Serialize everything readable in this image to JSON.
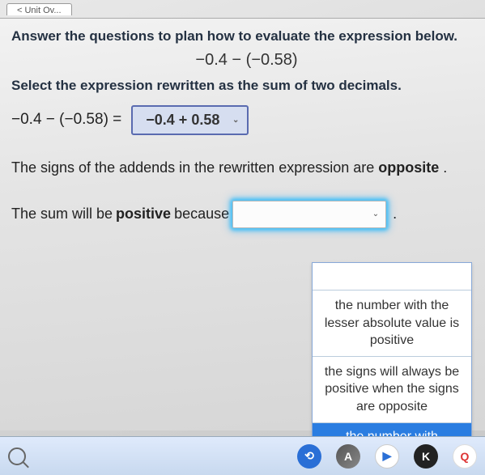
{
  "tab": {
    "label": "< Unit Ov..."
  },
  "q": {
    "instr": "Answer the questions to plan how to evaluate the expression below.",
    "expr": "−0.4 − (−0.58)",
    "sub": "Select the expression rewritten as the sum of two decimals.",
    "lhs": "−0.4 − (−0.58) =",
    "selected": "−0.4 + 0.58",
    "line3_a": "The signs of the addends in the rewritten expression are ",
    "line3_b": "opposite",
    "line3_c": " .",
    "line4_a": "The sum will be ",
    "line4_b": "positive",
    "line4_c": " because",
    "period": "."
  },
  "dd": {
    "opt1": "the number with the lesser absolute value is positive",
    "opt2": "the signs will always be positive when the signs are opposite",
    "opt3": "the number with"
  },
  "tb": {
    "a": "A",
    "play": "▶",
    "k": "K",
    "q": "Q"
  }
}
